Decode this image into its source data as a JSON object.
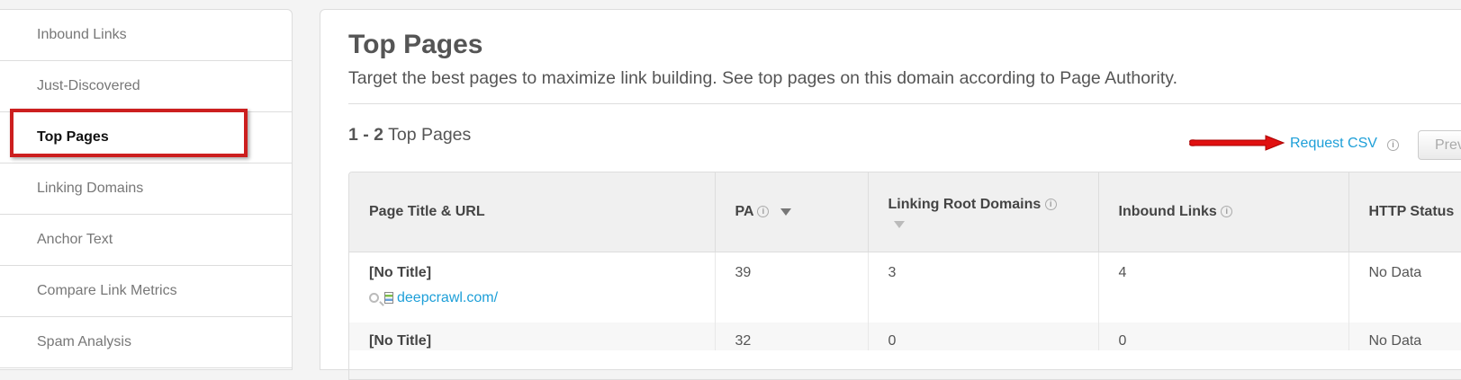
{
  "sidebar": {
    "items": [
      {
        "label": "Inbound Links"
      },
      {
        "label": "Just-Discovered"
      },
      {
        "label": "Top Pages"
      },
      {
        "label": "Linking Domains"
      },
      {
        "label": "Anchor Text"
      },
      {
        "label": "Compare Link Metrics"
      },
      {
        "label": "Spam Analysis"
      }
    ]
  },
  "header": {
    "title": "Top Pages",
    "subtitle": "Target the best pages to maximize link building. See top pages on this domain according to Page Authority."
  },
  "results": {
    "range": "1 - 2",
    "label": "Top Pages"
  },
  "actions": {
    "request_csv": "Request CSV",
    "prev": "Prev"
  },
  "table": {
    "columns": [
      "Page Title & URL",
      "PA",
      "Linking Root Domains",
      "Inbound Links",
      "HTTP Status"
    ],
    "rows": [
      {
        "title": "[No Title]",
        "url": "deepcrawl.com/",
        "pa": "39",
        "lrd": "3",
        "inbound": "4",
        "status": "No Data"
      },
      {
        "title": "[No Title]",
        "url": "",
        "pa": "32",
        "lrd": "0",
        "inbound": "0",
        "status": "No Data"
      }
    ]
  },
  "icons": {
    "info": "i",
    "arrow_color": "#e01010",
    "highlight_color": "#cc1f1f",
    "link_color": "#1d9fd8"
  }
}
